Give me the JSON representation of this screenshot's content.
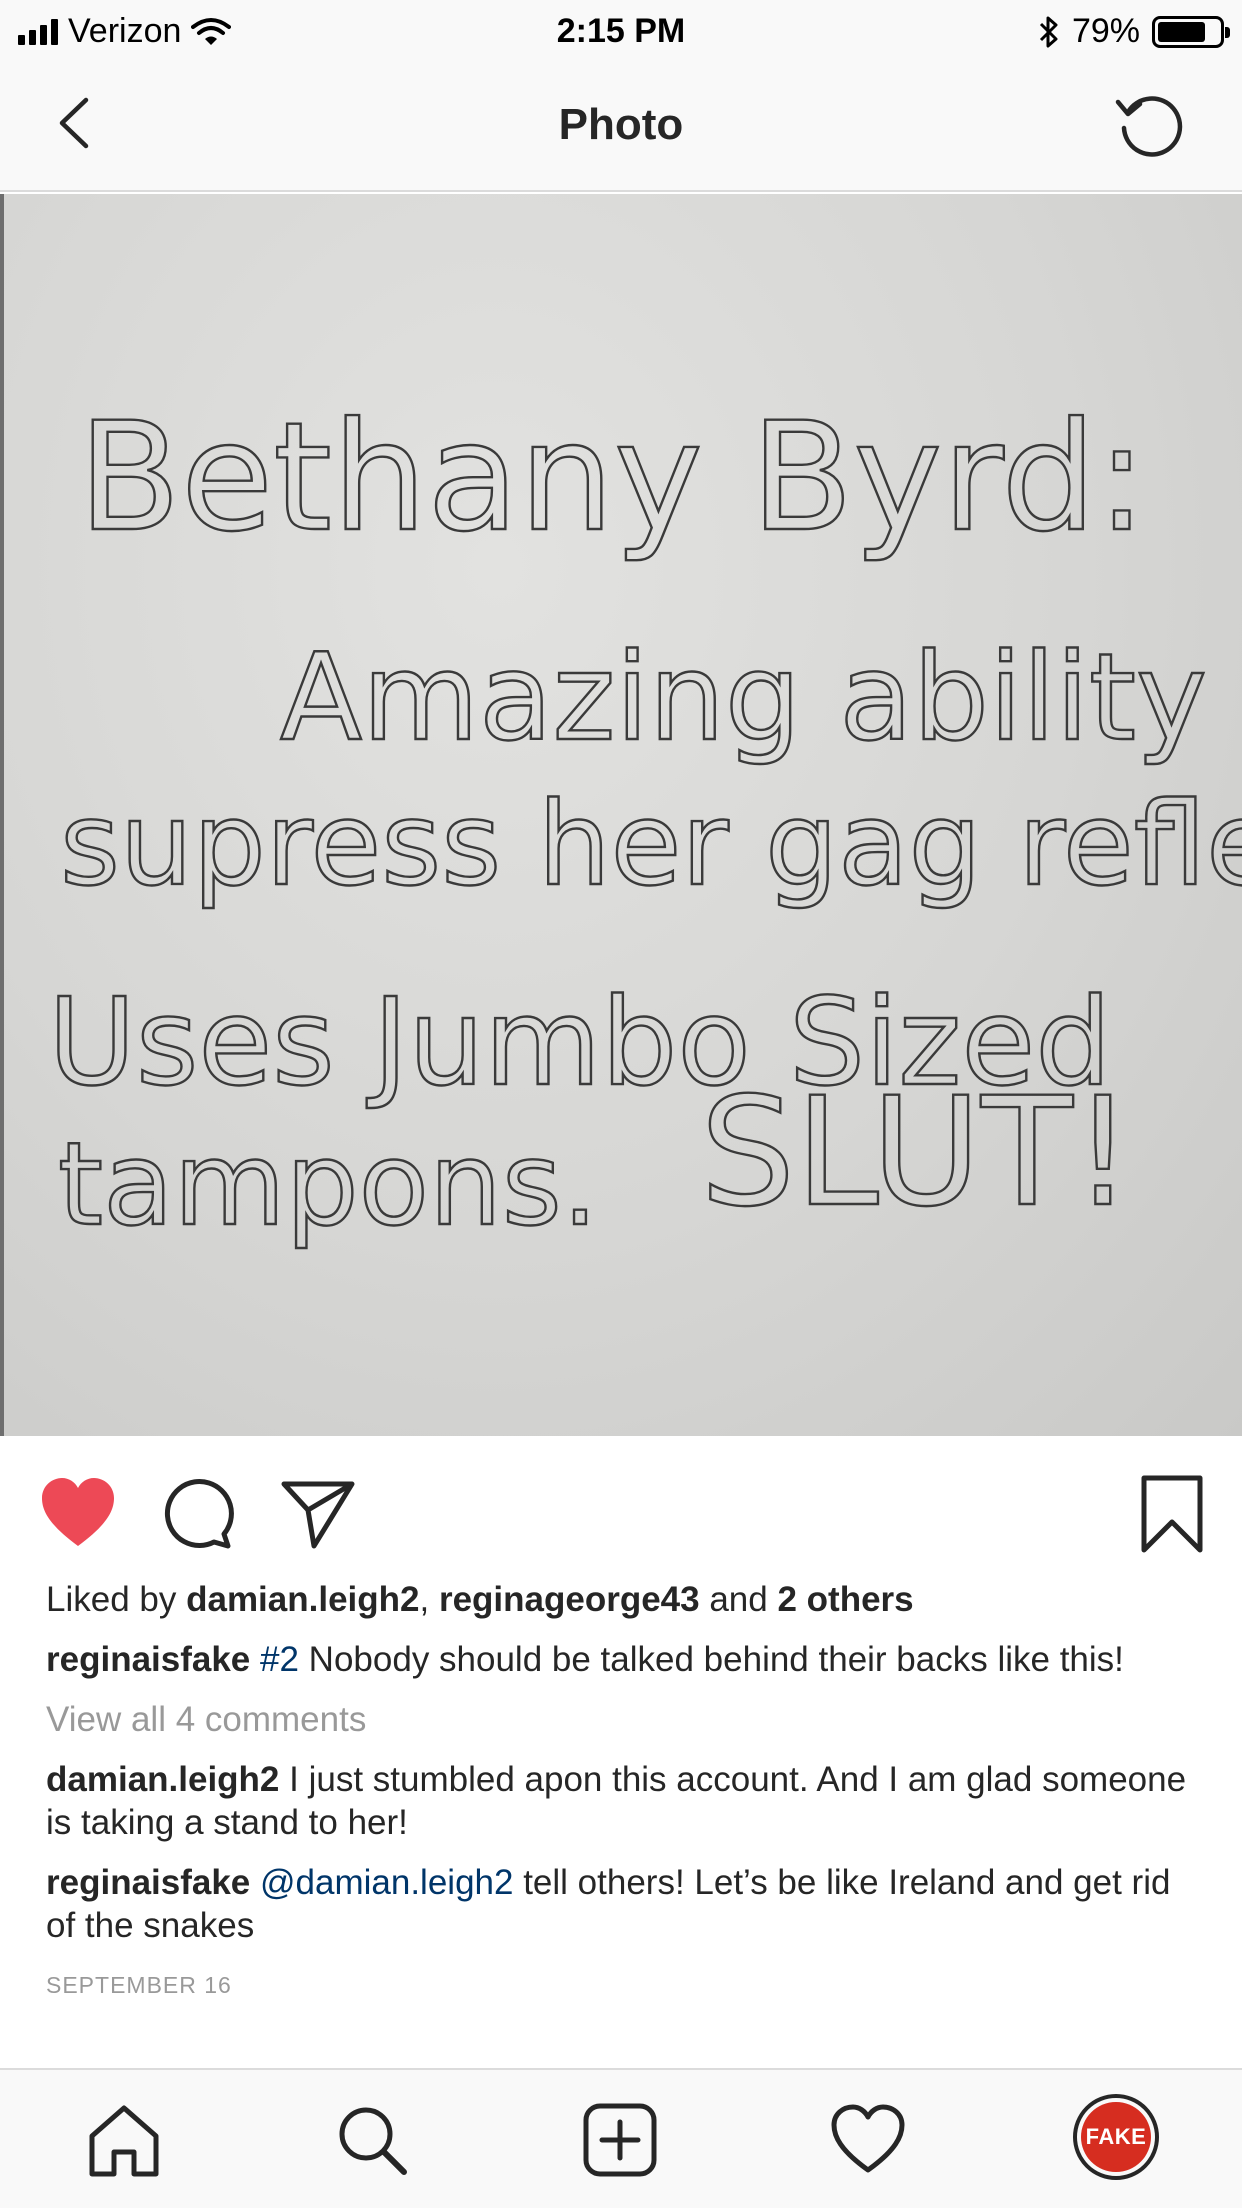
{
  "status_bar": {
    "carrier": "Verizon",
    "time": "2:15 PM",
    "battery_percent": "79%",
    "battery_level": 0.79,
    "signal_bars": 4
  },
  "nav": {
    "title": "Photo",
    "back_icon": "chevron-left-icon",
    "refresh_icon": "refresh-icon"
  },
  "photo": {
    "handwriting_lines": [
      "Bethany Byrd:",
      "Amazing ability to",
      "supress her gag reflex.",
      "Uses Jumbo Sized",
      "tampons.",
      "SLUT!"
    ]
  },
  "actions": {
    "like_icon": "heart-filled-icon",
    "comment_icon": "comment-icon",
    "share_icon": "paper-plane-icon",
    "save_icon": "bookmark-icon",
    "like_color": "#ed4956"
  },
  "likes": {
    "prefix": "Liked by ",
    "user1": "damian.leigh2",
    "sep": ", ",
    "user2": "reginageorge43",
    "and": " and ",
    "others": "2 others"
  },
  "caption": {
    "username": "reginaisfake",
    "hashtag": "#2",
    "text": " Nobody should be talked behind their backs like this!"
  },
  "view_comments": "View all 4 comments",
  "comments": [
    {
      "username": "damian.leigh2",
      "mention": "",
      "text": " I just stumbled apon this account. And I am glad someone is taking a stand to her!"
    },
    {
      "username": "reginaisfake",
      "mention": "@damian.leigh2",
      "text": " tell others! Let’s be like Ireland and get rid of the snakes"
    }
  ],
  "date": "SEPTEMBER 16",
  "tab_bar": {
    "home_icon": "home-icon",
    "search_icon": "search-icon",
    "add_icon": "add-post-icon",
    "activity_icon": "heart-outline-icon",
    "profile_label": "FAKE"
  }
}
